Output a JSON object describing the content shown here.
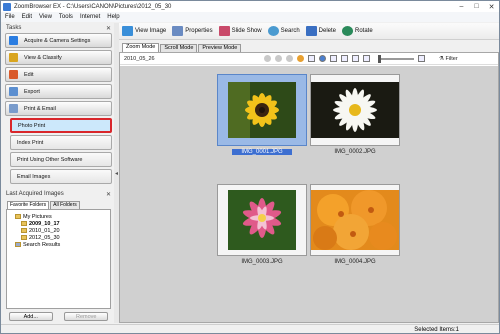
{
  "window": {
    "title": "ZoomBrowser EX - C:\\Users\\CANON\\Pictures\\2012_05_30",
    "controls": [
      "–",
      "□",
      "✕"
    ]
  },
  "menu": [
    "File",
    "Edit",
    "View",
    "Tools",
    "Internet",
    "Help"
  ],
  "tasks": {
    "header": "Tasks",
    "items": [
      {
        "label": "Acquire & Camera Settings",
        "color": "#2b7de1"
      },
      {
        "label": "View & Classify",
        "color": "#d9a520"
      },
      {
        "label": "Edit",
        "color": "#d95a2b"
      },
      {
        "label": "Export",
        "color": "#5c8fd0"
      },
      {
        "label": "Print & Email",
        "color": "#7a9ccc"
      }
    ],
    "subitems": [
      {
        "label": "Photo Print"
      },
      {
        "label": "Index Print"
      },
      {
        "label": "Print Using Other Software"
      },
      {
        "label": "Email Images"
      }
    ]
  },
  "acquired": {
    "header": "Last Acquired Images",
    "tabs": [
      "Favorite Folders",
      "All Folders"
    ],
    "tree": [
      {
        "label": "My Pictures",
        "bold": false,
        "indent": 1
      },
      {
        "label": "2009_10_17",
        "bold": true,
        "indent": 2
      },
      {
        "label": "2010_01_20",
        "bold": false,
        "indent": 2
      },
      {
        "label": "2012_05_30",
        "bold": false,
        "indent": 2
      },
      {
        "label": "Search Results",
        "bold": false,
        "indent": 1
      }
    ],
    "add_label": "Add...",
    "remove_label": "Remove"
  },
  "toolbar": [
    {
      "label": "View Image",
      "color": "#3a8fd9"
    },
    {
      "label": "Properties",
      "color": "#6a8bc2"
    },
    {
      "label": "Slide Show",
      "color": "#c94a6a"
    },
    {
      "label": "Search",
      "color": "#4a9ad0"
    },
    {
      "label": "Delete",
      "color": "#3a6fc2"
    },
    {
      "label": "Rotate",
      "color": "#2a8a5a"
    }
  ],
  "view_tabs": [
    "Zoom Mode",
    "Scroll Mode",
    "Preview Mode"
  ],
  "content": {
    "folder_date": "2010_05_26",
    "filter_label": "Filter"
  },
  "thumbnails": [
    {
      "filename": "IMG_0001.JPG",
      "selected": true
    },
    {
      "filename": "IMG_0002.JPG",
      "selected": false
    },
    {
      "filename": "IMG_0003.JPG",
      "selected": false
    },
    {
      "filename": "IMG_0004.JPG",
      "selected": false
    }
  ],
  "status": {
    "selected_items": "Selected Items:1"
  }
}
